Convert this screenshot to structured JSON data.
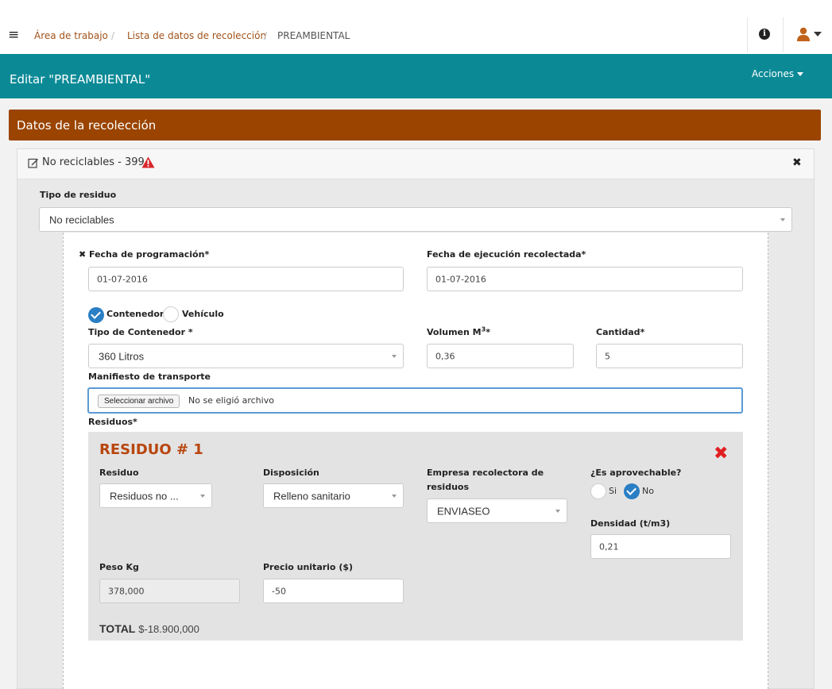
{
  "topbar": {
    "menu_icon": "hamburger-icon",
    "breadcrumbs": [
      "Área de trabajo",
      "/",
      "Lista de datos de recolección",
      "/",
      "PREAMBIENTAL"
    ],
    "info_icon": "info-icon",
    "user_icon": "user-icon"
  },
  "header": {
    "title": "Editar \"PREAMBIENTAL\"",
    "actions_label": "Acciones",
    "color": "#0b8a96"
  },
  "section": {
    "title": "Datos de la recolección",
    "color": "#9a4400"
  },
  "card": {
    "title": "No reciclables - 399",
    "edit_icon": "edit-icon",
    "warning_icon": "warning-icon",
    "close_icon": "close-icon",
    "tipo_residuo_label": "Tipo de residuo",
    "tipo_residuo_value": "No reciclables"
  },
  "form": {
    "fecha_programacion_label": "Fecha de programación*",
    "fecha_programacion_value": "01-07-2016",
    "fecha_ejecucion_label": "Fecha de ejecución recolectada*",
    "fecha_ejecucion_value": "01-07-2016",
    "radio_contenedor": "Contenedor",
    "radio_vehiculo": "Vehículo",
    "selected_option": "Contenedor",
    "tipo_contenedor_label": "Tipo de Contenedor *",
    "tipo_contenedor_value": "360 Litros",
    "volumen_label_pre": "Volumen M",
    "volumen_label_sup": "3",
    "volumen_label_post": "*",
    "volumen_value": "0,36",
    "cantidad_label": "Cantidad*",
    "cantidad_value": "5",
    "manifiesto_label": "Manifiesto de transporte",
    "file_button": "Seleccionar archivo",
    "file_status": "No se eligió archivo",
    "residuos_label": "Residuos*"
  },
  "residuo": {
    "title": "RESIDUO # 1",
    "delete_icon": "delete-icon",
    "residuo_label": "Residuo",
    "residuo_value": "Residuos no ...",
    "disposicion_label": "Disposición",
    "disposicion_value": "Relleno sanitario",
    "empresa_label_1": "Empresa recolectora de",
    "empresa_label_2": "residuos",
    "empresa_value": "ENVIASEO",
    "aprovechable_label": "¿Es aprovechable?",
    "si_label": "Si",
    "no_label": "No",
    "aprovechable_selected": "No",
    "densidad_label": "Densidad (t/m3)",
    "densidad_value": "0,21",
    "peso_label": "Peso Kg",
    "peso_value": "378,000",
    "precio_label": "Precio unitario ($)",
    "precio_value": "-50",
    "total_label": "TOTAL",
    "total_value": "$-18.900,000"
  }
}
